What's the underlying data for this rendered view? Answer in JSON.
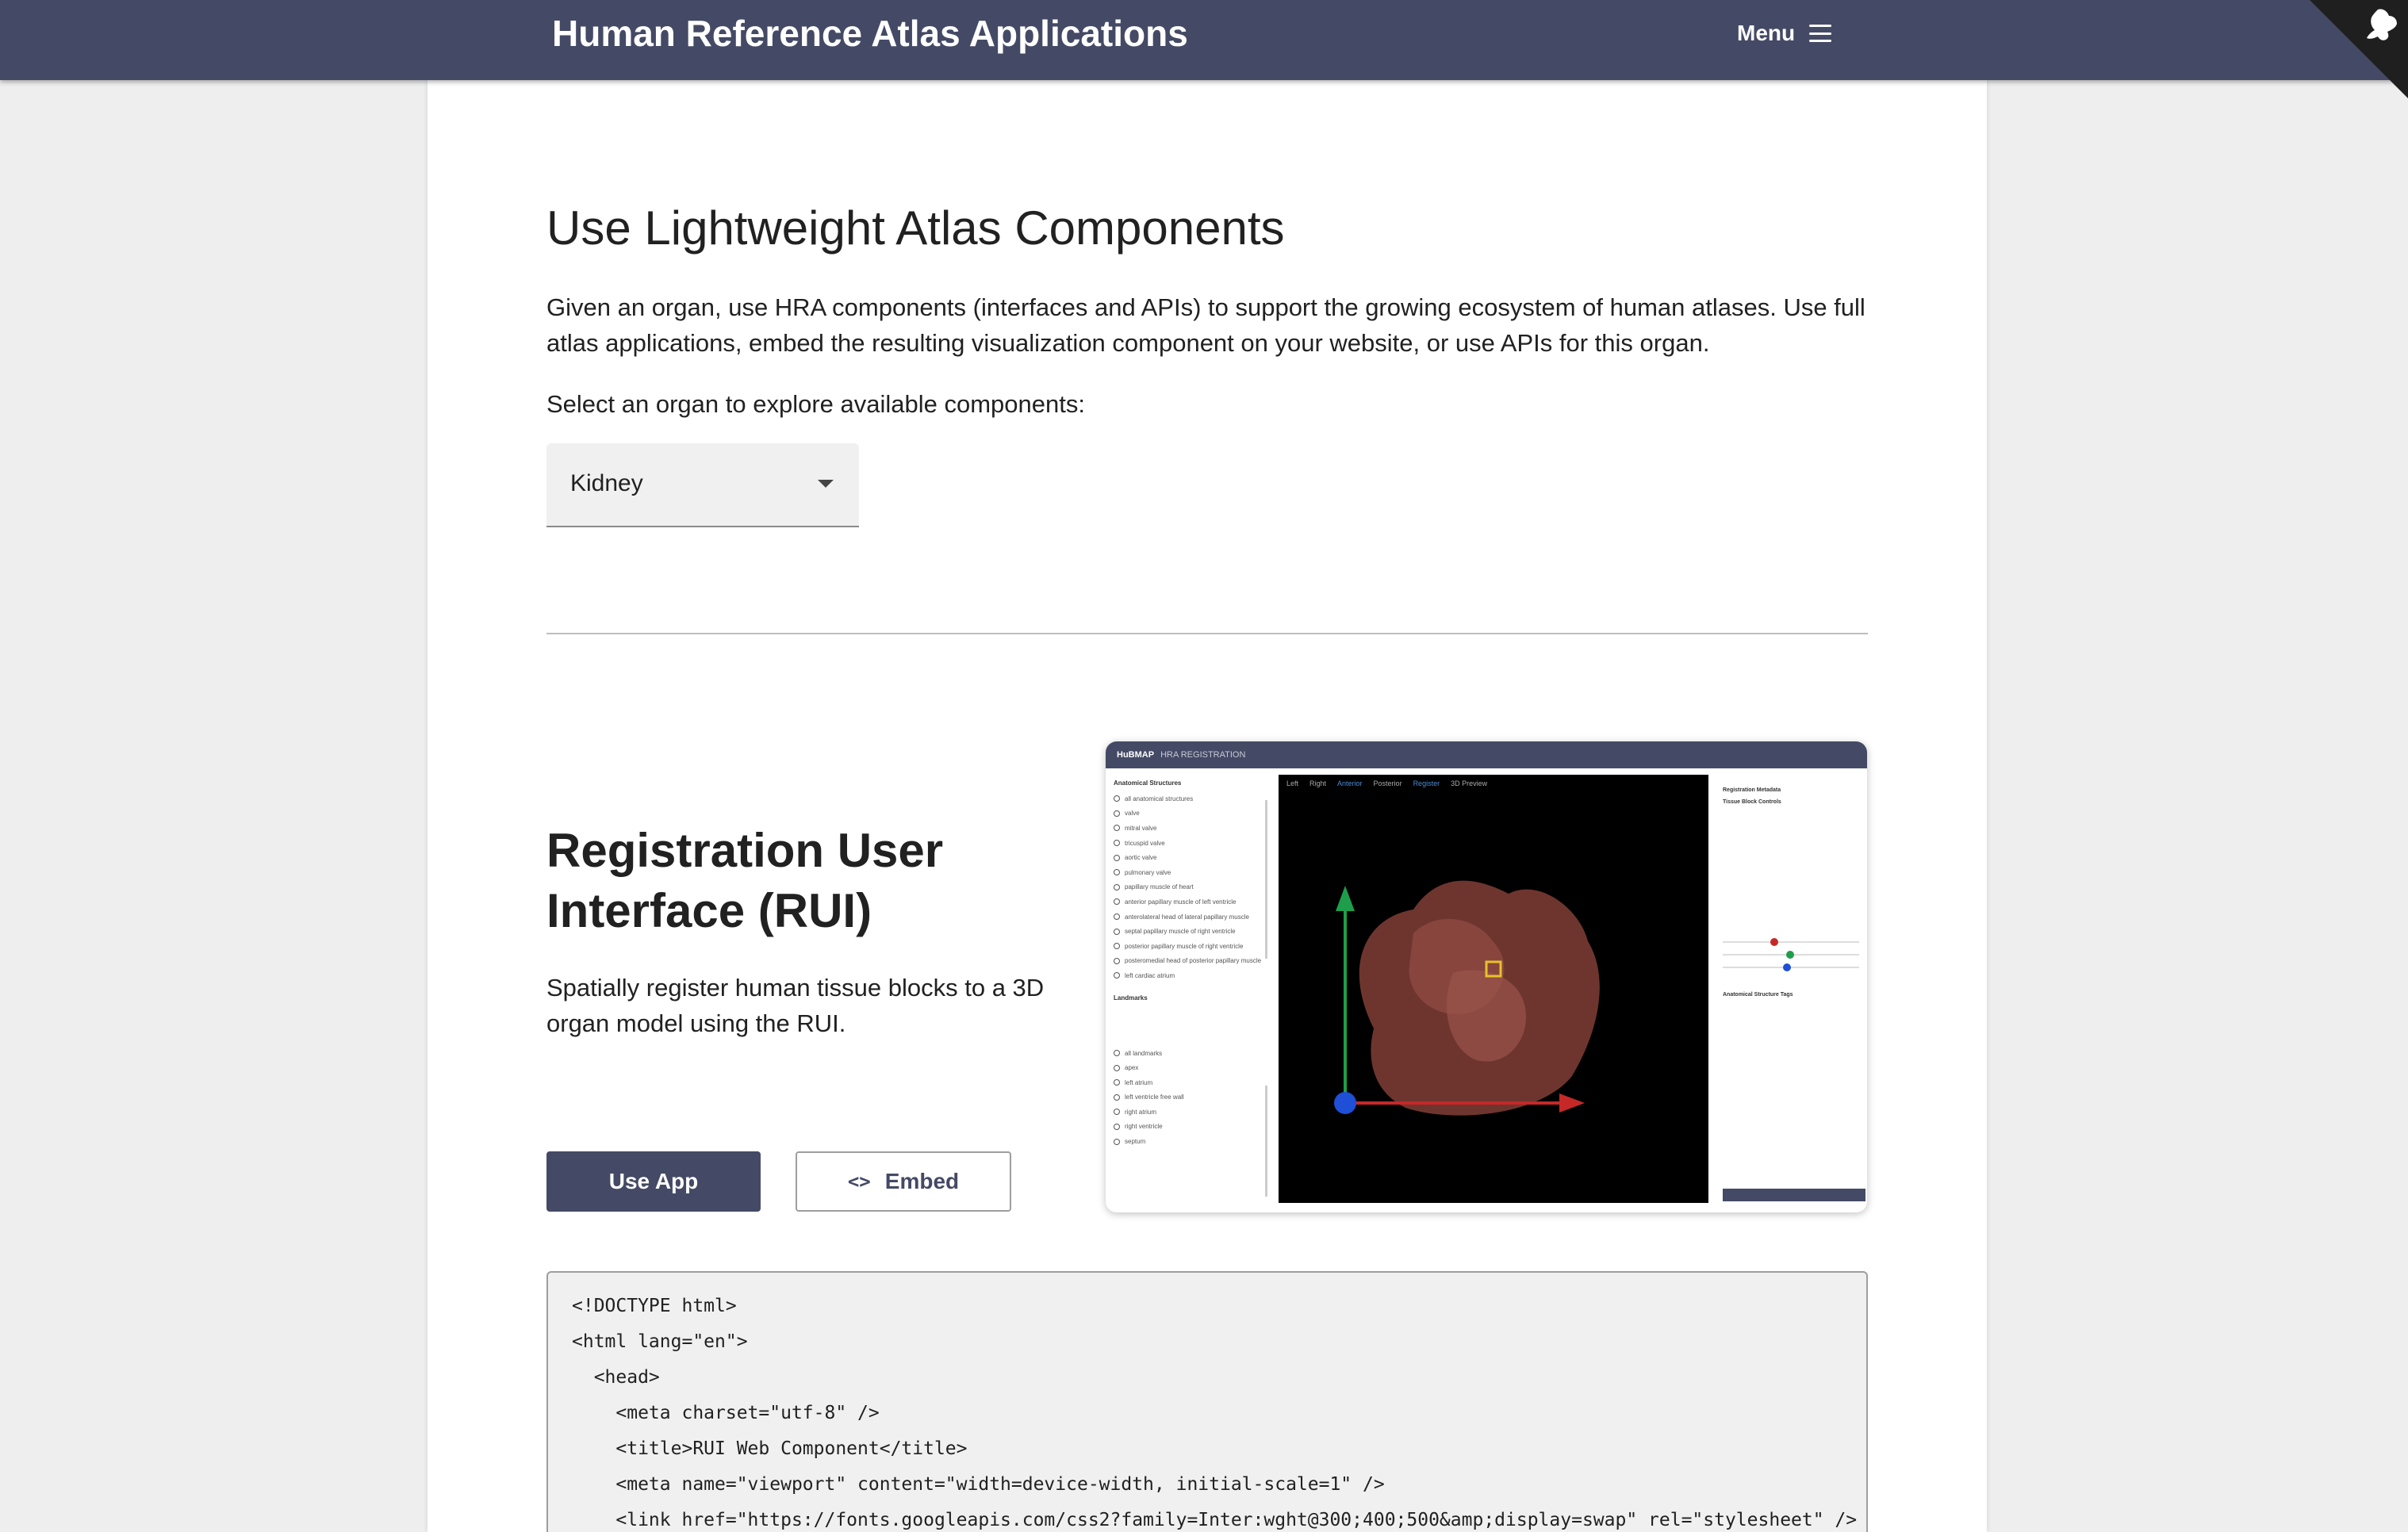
{
  "header": {
    "title": "Human Reference Atlas Applications",
    "menu_label": "Menu"
  },
  "intro": {
    "heading": "Use Lightweight Atlas Components",
    "paragraph": "Given an organ, use HRA components (interfaces and APIs) to support the growing ecosystem of human atlases. Use full atlas applications, embed the resulting visualization component on your website, or use APIs for this organ.",
    "select_prompt": "Select an organ to explore available components:",
    "organ_selected": "Kidney"
  },
  "rui": {
    "title": "Registration User Interface (RUI)",
    "description": "Spatially register human tissue blocks to a 3D organ model using the RUI.",
    "use_app_label": "Use App",
    "embed_label": "Embed",
    "embed_icon": "<>"
  },
  "preview": {
    "brand": "HuBMAP",
    "app_name": "HRA REGISTRATION",
    "tabs": [
      "Left",
      "Right",
      "Anterior",
      "Posterior",
      "Register",
      "3D Preview"
    ],
    "structures_heading": "Anatomical Structures",
    "structures": [
      "all anatomical structures",
      "valve",
      "mitral valve",
      "tricuspid valve",
      "aortic valve",
      "pulmonary valve",
      "papillary muscle of heart",
      "anterior papillary muscle of left ventricle",
      "anterolateral head of lateral papillary muscle",
      "septal papillary muscle of right ventricle",
      "posterior papillary muscle of right ventricle",
      "posteromedial head of posterior papillary muscle",
      "left cardiac atrium"
    ],
    "landmarks_heading": "Landmarks",
    "landmarks": [
      "all landmarks",
      "apex",
      "left atrium",
      "left ventricle free wall",
      "right atrium",
      "right ventricle",
      "septum"
    ],
    "metadata_heading": "Registration Metadata",
    "controls_heading": "Tissue Block Controls",
    "tags_heading": "Anatomical Structure Tags"
  },
  "code": {
    "lines": [
      "<!DOCTYPE html>",
      "<html lang=\"en\">",
      "  <head>",
      "    <meta charset=\"utf-8\" />",
      "    <title>RUI Web Component</title>",
      "    <meta name=\"viewport\" content=\"width=device-width, initial-scale=1\" />",
      "    <link href=\"https://fonts.googleapis.com/css2?family=Inter:wght@300;400;500&amp;display=swap\" rel=\"stylesheet\" />"
    ]
  }
}
